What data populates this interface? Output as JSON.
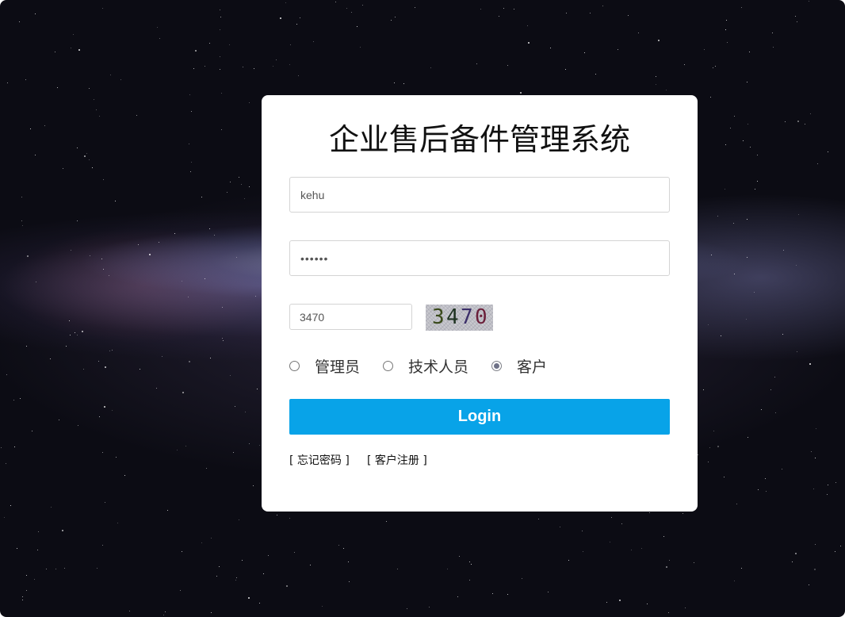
{
  "app": {
    "title": "企业售后备件管理系统"
  },
  "form": {
    "username_value": "kehu",
    "password_value": "••••••",
    "captcha_value": "3470",
    "captcha_image_text": [
      "3",
      "4",
      "7",
      "0"
    ],
    "captcha_digit_colors": [
      "#3a4a1c",
      "#1f3322",
      "#3c2f6a",
      "#6b1f3a"
    ]
  },
  "roles": [
    {
      "label": "管理员",
      "checked": false
    },
    {
      "label": "技术人员",
      "checked": false
    },
    {
      "label": "客户",
      "checked": true
    }
  ],
  "actions": {
    "login_label": "Login",
    "forgot_password_label": "[ 忘记密码 ]",
    "register_label": "[ 客户注册 ]"
  },
  "colors": {
    "button": "#08a3e8",
    "card": "#ffffff",
    "background": "#0b0b12"
  }
}
